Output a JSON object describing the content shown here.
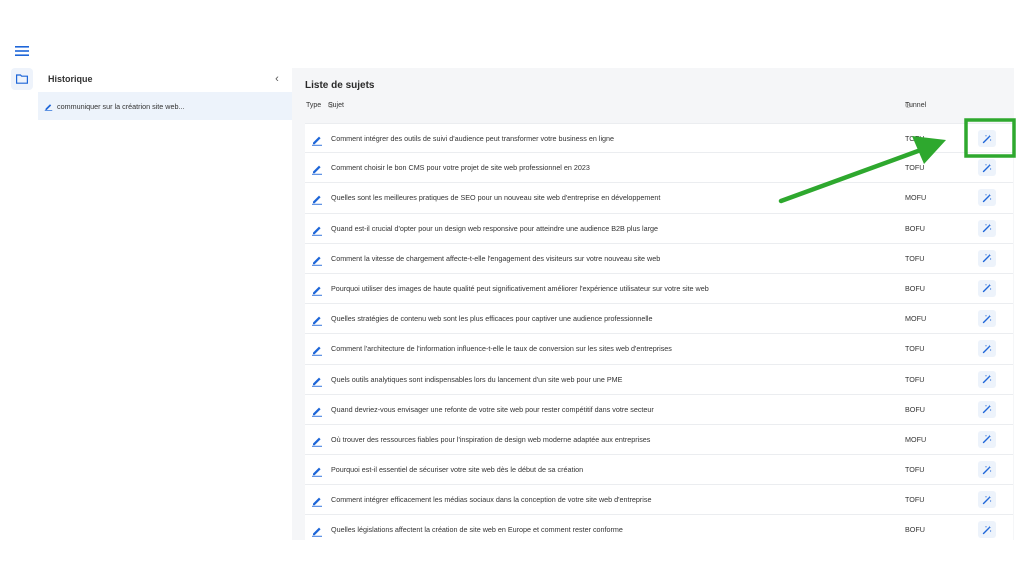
{
  "rail": {
    "menu_icon": "hamburger-menu-icon",
    "folder_icon": "folder-icon"
  },
  "history": {
    "title": "Historique",
    "collapse_icon": "chevron-left-icon",
    "items": [
      {
        "label": "communiquer sur la créatrion site web..."
      }
    ]
  },
  "main": {
    "title": "Liste de sujets",
    "columns": {
      "type": "Type",
      "subject": "Sujet",
      "tunnel": "Tunnel"
    },
    "rows": [
      {
        "subject": "Comment intégrer des outils de suivi d'audience peut transformer votre business en ligne",
        "tunnel": "TOFU"
      },
      {
        "subject": "Comment choisir le bon CMS pour votre projet de site web professionnel en 2023",
        "tunnel": "TOFU"
      },
      {
        "subject": "Quelles sont les meilleures pratiques de SEO pour un nouveau site web d'entreprise en développement",
        "tunnel": "MOFU"
      },
      {
        "subject": "Quand est-il crucial d'opter pour un design web responsive pour atteindre une audience B2B plus large",
        "tunnel": "BOFU"
      },
      {
        "subject": "Comment la vitesse de chargement affecte-t-elle l'engagement des visiteurs sur votre nouveau site web",
        "tunnel": "TOFU"
      },
      {
        "subject": "Pourquoi utiliser des images de haute qualité peut significativement améliorer l'expérience utilisateur sur votre site web",
        "tunnel": "BOFU"
      },
      {
        "subject": "Quelles stratégies de contenu web sont les plus efficaces pour captiver une audience professionnelle",
        "tunnel": "MOFU"
      },
      {
        "subject": "Comment l'architecture de l'information influence-t-elle le taux de conversion sur les sites web d'entreprises",
        "tunnel": "TOFU"
      },
      {
        "subject": "Quels outils analytiques sont indispensables lors du lancement d'un site web pour une PME",
        "tunnel": "TOFU"
      },
      {
        "subject": "Quand devriez-vous envisager une refonte de votre site web pour rester compétitif dans votre secteur",
        "tunnel": "BOFU"
      },
      {
        "subject": "Où trouver des ressources fiables pour l'inspiration de design web moderne adaptée aux entreprises",
        "tunnel": "MOFU"
      },
      {
        "subject": "Pourquoi est-il essentiel de sécuriser votre site web dès le début de sa création",
        "tunnel": "TOFU"
      },
      {
        "subject": "Comment intégrer efficacement les médias sociaux dans la conception de votre site web d'entreprise",
        "tunnel": "TOFU"
      },
      {
        "subject": "Quelles législations affectent la création de site web en Europe et comment rester conforme",
        "tunnel": "BOFU"
      }
    ],
    "row_icons": {
      "edit": "pencil-icon",
      "action": "magic-wand-icon"
    }
  },
  "colors": {
    "accent": "#1e66d8",
    "highlight_bg": "#edf3fb",
    "annotation": "#2ea82e"
  },
  "annotation": {
    "arrow": "green-arrow-annotation",
    "box": "green-highlight-box"
  }
}
